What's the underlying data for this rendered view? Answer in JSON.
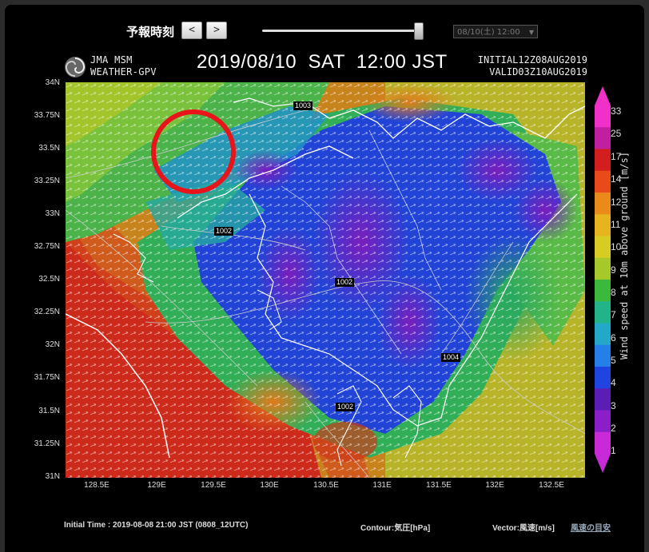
{
  "controls": {
    "forecast_time_label": "予報時刻",
    "prev_label": "<",
    "next_label": ">",
    "slider_position": 1.0,
    "time_select_value": "08/10(土) 12:00"
  },
  "header": {
    "model_line1": "JMA MSM",
    "model_line2": "WEATHER-GPV",
    "datetime": "2019/08/10  SAT  12:00 JST",
    "initial": "INITIAL12Z08AUG2019",
    "valid": "VALID03Z10AUG2019"
  },
  "map": {
    "y_labels": [
      "34N",
      "33.75N",
      "33.5N",
      "33.25N",
      "33N",
      "32.75N",
      "32.5N",
      "32.25N",
      "32N",
      "31.75N",
      "31.5N",
      "31.25N",
      "31N"
    ],
    "x_labels": [
      "128.5E",
      "129E",
      "129.5E",
      "130E",
      "130.5E",
      "131E",
      "131.5E",
      "132E",
      "132.5E"
    ],
    "contour_labels": [
      "1003",
      "1002",
      "1002",
      "1004",
      "1002"
    ],
    "highlight_circle": "red-circle-annotation"
  },
  "colorbar": {
    "labels": [
      "33",
      "25",
      "17",
      "14",
      "12",
      "11",
      "10",
      "9",
      "8",
      "7",
      "6",
      "5",
      "4",
      "3",
      "2",
      "1"
    ],
    "colors": [
      "#f030c8",
      "#c020a0",
      "#d21e1e",
      "#e84a1a",
      "#ea8a1a",
      "#e6b41e",
      "#d6cc24",
      "#a6c82a",
      "#3cb83c",
      "#22b488",
      "#24a8c8",
      "#2480e8",
      "#2044e0",
      "#5a1eb4",
      "#8a1ec8",
      "#c82ad8"
    ],
    "title": "Wind speed at 10m above ground [m/s]"
  },
  "footer": {
    "initial_time": "Initial Time : 2019-08-08 21:00 JST (0808_12UTC)",
    "contour": "Contour:気圧[hPa]",
    "vector": "Vector:風速[m/s]",
    "link": "風速の目安"
  }
}
